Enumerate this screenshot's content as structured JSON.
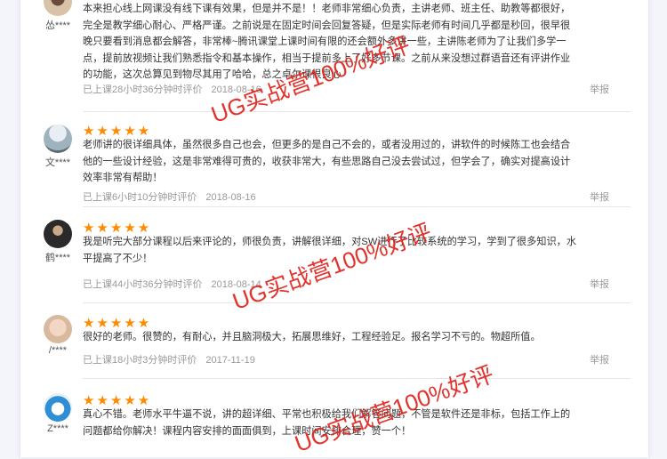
{
  "reviews": [
    {
      "user": "怂****",
      "text": "本来担心线上网课没有线下课有效果，但是并不是！！老师非常细心负责，主讲老师、班主任、助教等都很好，完全是教学细心耐心、严格严谨。之前说是在固定时间会回复答疑，但是实际老师有时间几乎都是秒回，很早很晚只要看到消息都会解答，非常棒~腾讯课堂上课时间有限的还会额外多讲一些，主讲陈老师为了让我们多学一点，提前放视频让我们熟悉指令和基本操作，相当于提前多上了好多节课。之前从来没想过群语音还有评讲作业的功能，这次总算见到物尽其用了哈哈，总之卓尔课很良心",
      "duration": "已上课28小时36分钟时评价",
      "date": "2018-08-16",
      "report": "举报"
    },
    {
      "user": "文****",
      "text": "老师讲的很详细具体，虽然很多自己也会，但更多的是自己不会的，或者没用过的，讲软件的时候陈工也会结合他的一些设计经验，这是非常难得可贵的，收获非常大，有些思路自己没去尝试过，但学会了，确实对提高设计效率非常有帮助！",
      "duration": "已上课6小时10分钟时评价",
      "date": "2018-08-16",
      "report": "举报"
    },
    {
      "user": "鹤****",
      "text": "我是听完大部分课程以后来评论的，师很负责，讲解很详细，对SW进行了比较系统的学习，学到了很多知识，水平提高了不少！",
      "duration": "已上课44小时36分钟时评价",
      "date": "2018-08-14",
      "report": "举报"
    },
    {
      "user": "/****",
      "text": "很好的老师。很赞的，有耐心，并且脑洞极大，拓展思维好，工程经验足。报名学习不亏的。物超所值。",
      "duration": "已上课18小时3分钟时评价",
      "date": "2017-11-19",
      "report": "举报"
    },
    {
      "user": "Z****",
      "text": "真心不错。老师水平牛逼不说，讲的超详细、平常也积极给我们解答问题，不管是软件还是非标，包括工作上的问题都给你解决！课程内容安排的面面俱到，上课时间安排合理，赞一个！",
      "duration": "",
      "date": "",
      "report": ""
    }
  ],
  "stars": "★★★★★",
  "watermark_text": "UG实战营100%好评",
  "colors": {
    "star": "#ff8a00",
    "watermark": "#e0231c"
  }
}
